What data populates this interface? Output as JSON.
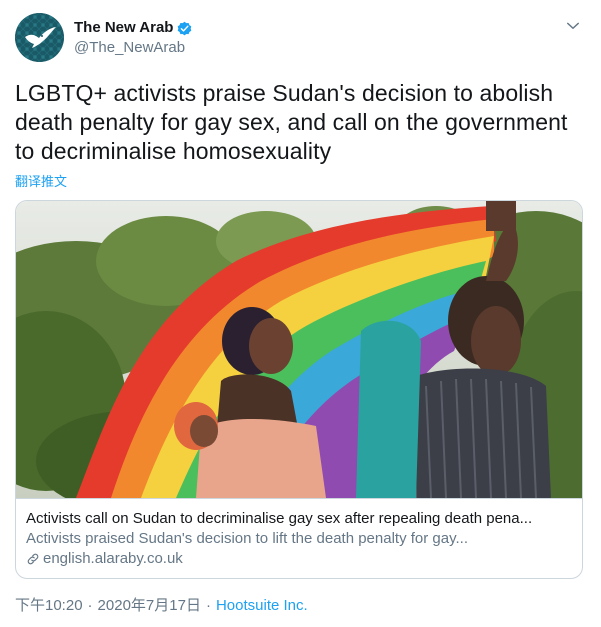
{
  "author": {
    "display_name": "The New Arab",
    "handle": "@The_NewArab",
    "verified_icon": "verified-badge-icon",
    "avatar_icon": "bird-logo-icon"
  },
  "tweet": {
    "text": "LGBTQ+ activists praise Sudan's decision to abolish death penalty for gay sex, and call on the government to decriminalise homosexuality",
    "translate_label": "翻译推文"
  },
  "card": {
    "title": "Activists call on Sudan to decriminalise gay sex after repealing death pena...",
    "description": "Activists praised Sudan's decision to lift the death penalty for gay...",
    "domain": "english.alaraby.co.uk",
    "link_icon": "link-icon",
    "image_description_icon": "rainbow-flag-photo"
  },
  "meta": {
    "time": "下午10:20",
    "separator": "·",
    "date": "2020年7月17日",
    "separator2": "·",
    "source": "Hootsuite Inc."
  },
  "colors": {
    "accent": "#1da1f2",
    "secondary_text": "#657786",
    "border": "#ccd6dd"
  }
}
